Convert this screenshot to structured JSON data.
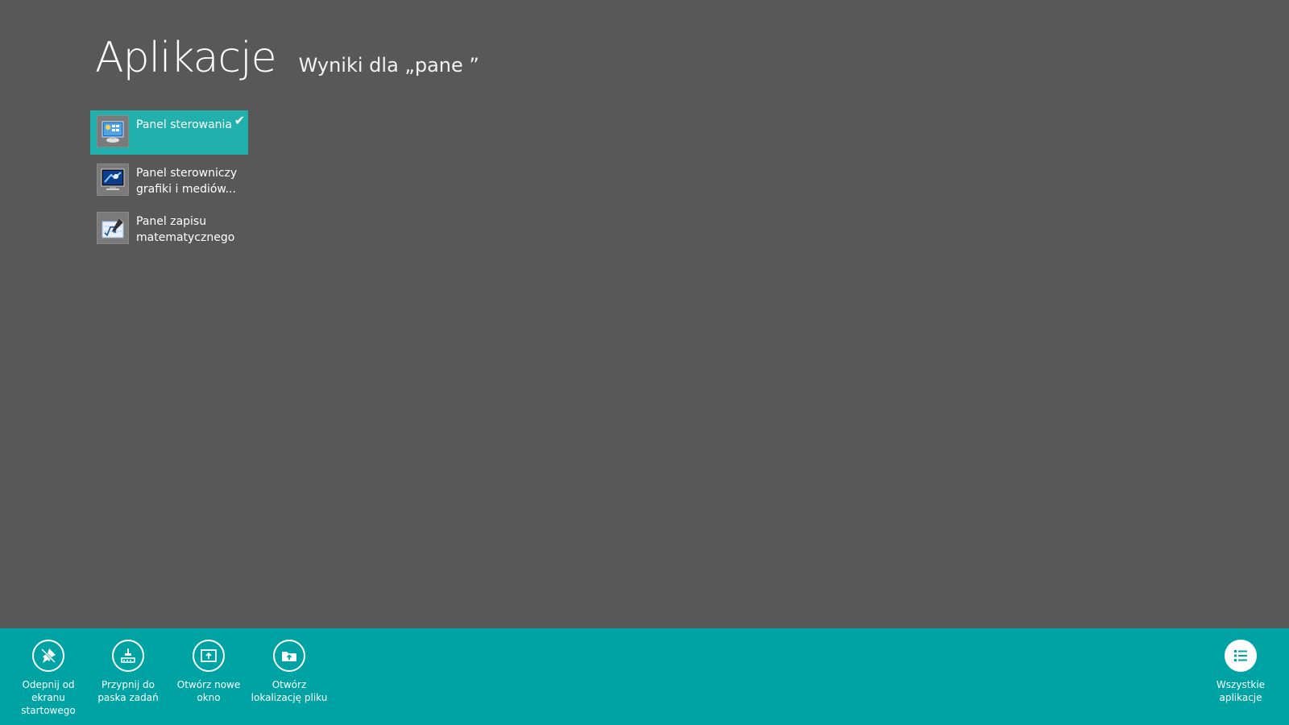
{
  "header": {
    "title": "Aplikacje",
    "results_label": "Wyniki dla „pane ”"
  },
  "results": [
    {
      "label": "Panel sterowania",
      "icon": "control-panel-icon",
      "selected": true
    },
    {
      "label": "Panel sterowniczy grafiki i mediów...",
      "icon": "graphics-media-panel-icon",
      "selected": false
    },
    {
      "label": "Panel zapisu matematycznego",
      "icon": "math-input-panel-icon",
      "selected": false
    }
  ],
  "app_bar": {
    "unpin_start": {
      "label": "Odepnij od\nekranu\nstartowego",
      "icon": "unpin-icon"
    },
    "pin_taskbar": {
      "label": "Przypnij do\npaska zadań",
      "icon": "pin-taskbar-icon"
    },
    "open_new_window": {
      "label": "Otwórz nowe\nokno",
      "icon": "new-window-icon"
    },
    "open_file_location": {
      "label": "Otwórz\nlokalizację pliku",
      "icon": "folder-icon"
    },
    "all_apps": {
      "label": "Wszystkie\naplikacje",
      "icon": "list-icon"
    }
  },
  "colors": {
    "background": "#585858",
    "accent": "#00a3a3",
    "selection": "#21b0ab"
  }
}
